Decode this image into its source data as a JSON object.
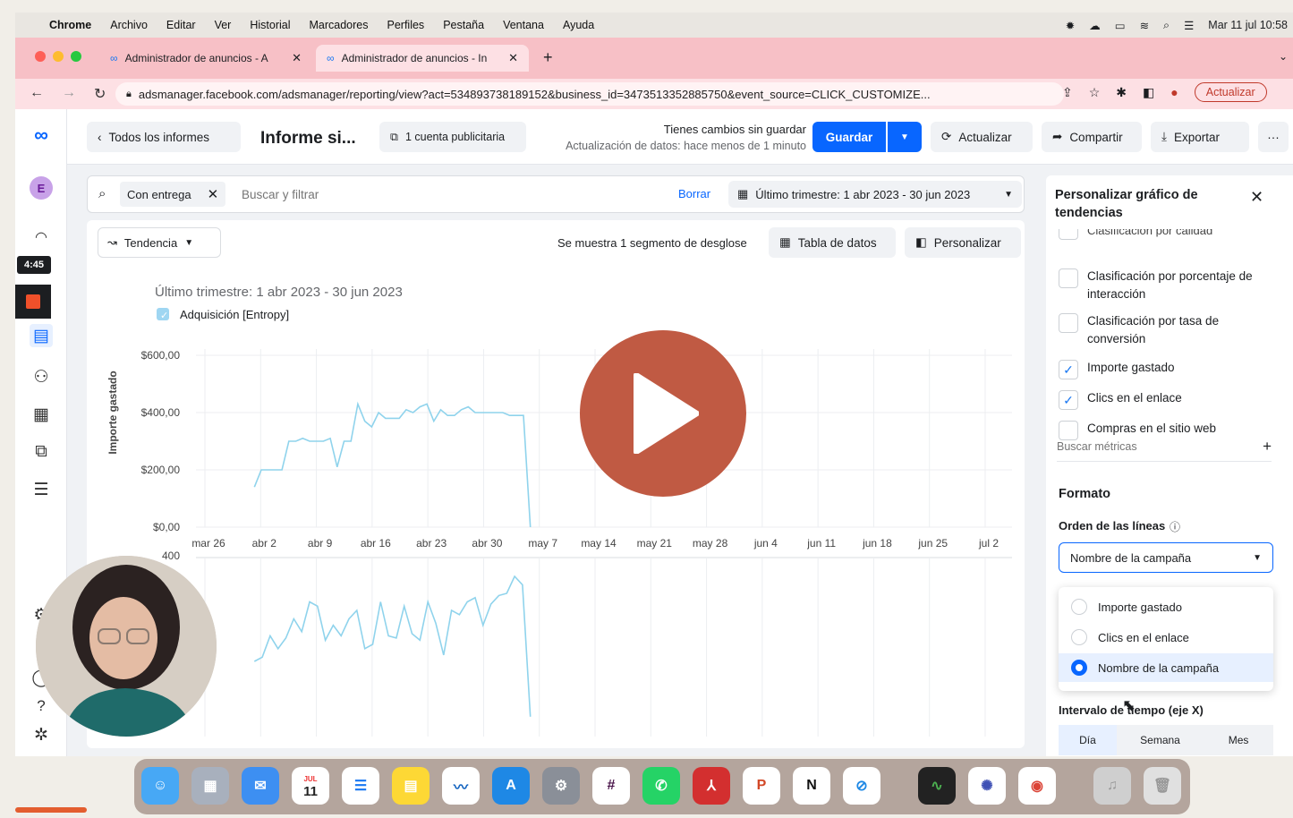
{
  "menubar": {
    "app": "Chrome",
    "items": [
      "Archivo",
      "Editar",
      "Ver",
      "Historial",
      "Marcadores",
      "Perfiles",
      "Pestaña",
      "Ventana",
      "Ayuda"
    ],
    "clock": "Mar 11 jul 10:58"
  },
  "tabs": [
    {
      "label": "Administrador de anuncios - A"
    },
    {
      "label": "Administrador de anuncios - In"
    }
  ],
  "url": "adsmanager.facebook.com/adsmanager/reporting/view?act=534893738189152&business_id=3473513352885750&event_source=CLICK_CUSTOMIZE...",
  "update_button": "Actualizar",
  "rail": {
    "avatar": "E",
    "timer": "4:45"
  },
  "topbar": {
    "back_label": "Todos los informes",
    "report_title": "Informe si...",
    "account_label": "1 cuenta publicitaria",
    "unsaved": "Tienes cambios sin guardar",
    "data_update": "Actualización de datos: hace menos de 1 minuto",
    "save": "Guardar",
    "refresh": "Actualizar",
    "share": "Compartir",
    "export": "Exportar",
    "more": "···"
  },
  "filter": {
    "chip": "Con entrega",
    "placeholder": "Buscar y filtrar",
    "clear": "Borrar",
    "date_range": "Último trimestre: 1 abr 2023 - 30 jun 2023"
  },
  "chart_toolbar": {
    "view": "Tendencia",
    "breakdown": "Se muestra 1 segmento de desglose",
    "data_table": "Tabla de datos",
    "customize": "Personalizar"
  },
  "chart_data": [
    {
      "type": "line",
      "title": "Último trimestre: 1 abr 2023 - 30 jun 2023",
      "ylabel": "Importe gastado",
      "series": [
        {
          "name": "Adquisición [Entropy]",
          "color": "#8fd3ec",
          "values": [
            140,
            200,
            200,
            200,
            200,
            300,
            300,
            310,
            300,
            300,
            300,
            310,
            210,
            300,
            300,
            430,
            370,
            350,
            400,
            380,
            380,
            380,
            410,
            400,
            420,
            430,
            370,
            410,
            390,
            390,
            410,
            420,
            400,
            400,
            400,
            400,
            400,
            390,
            390,
            390,
            0
          ]
        }
      ],
      "x_ticks": [
        "mar 26",
        "abr 2",
        "abr 9",
        "abr 16",
        "abr 23",
        "abr 30",
        "may 7",
        "may 14",
        "may 21",
        "may 28",
        "jun 4",
        "jun 11",
        "jun 18",
        "jun 25",
        "jul 2"
      ],
      "y_ticks": [
        "$600,00",
        "$400,00",
        "$200,00",
        "$0,00"
      ],
      "ylim": [
        0,
        600
      ],
      "grid": true,
      "legend": "top-left"
    },
    {
      "type": "line",
      "y_ticks": [
        "400"
      ],
      "ylim": [
        0,
        400
      ],
      "series": [
        {
          "color": "#8fd3ec",
          "values": [
            160,
            170,
            220,
            190,
            215,
            260,
            230,
            300,
            290,
            210,
            245,
            220,
            260,
            280,
            190,
            200,
            300,
            220,
            215,
            290,
            225,
            210,
            300,
            250,
            175,
            280,
            270,
            300,
            310,
            245,
            295,
            315,
            320,
            360,
            340,
            30
          ]
        }
      ]
    }
  ],
  "side_panel": {
    "title": "Personalizar gráfico de tendencias",
    "cut_label": "Clasificación por calidad",
    "metrics": [
      {
        "label": "Clasificación por porcentaje de interacción",
        "checked": false
      },
      {
        "label": "Clasificación por tasa de conversión",
        "checked": false
      },
      {
        "label": "Importe gastado",
        "checked": true
      },
      {
        "label": "Clics en el enlace",
        "checked": true
      },
      {
        "label": "Compras en el sitio web",
        "checked": false
      }
    ],
    "search_placeholder": "Buscar métricas",
    "format_heading": "Formato",
    "order_label": "Orden de las líneas",
    "order_value": "Nombre de la campaña",
    "order_options": [
      {
        "label": "Importe gastado",
        "selected": false
      },
      {
        "label": "Clics en el enlace",
        "selected": false
      },
      {
        "label": "Nombre de la campaña",
        "selected": true
      }
    ],
    "interval_label": "Intervalo de tiempo (eje X)",
    "interval_options": [
      "Día",
      "Semana",
      "Mes"
    ]
  },
  "dock_calendar": {
    "month": "JUL",
    "day": "11"
  }
}
